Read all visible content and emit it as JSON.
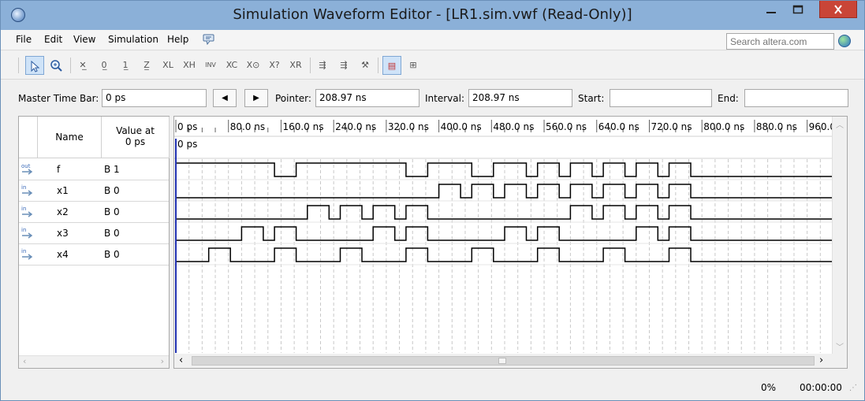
{
  "window": {
    "title": "Simulation Waveform Editor - [LR1.sim.vwf (Read-Only)]",
    "min_icon": "minimize-icon",
    "max_icon": "maximize-icon",
    "close_icon": "close-icon"
  },
  "menu": [
    "File",
    "Edit",
    "View",
    "Simulation",
    "Help"
  ],
  "search": {
    "placeholder": "Search altera.com"
  },
  "toolbar": {
    "icons": [
      "pointer-icon",
      "zoom-icon",
      "forcing-unknown-icon",
      "forcing-low-icon",
      "forcing-high-icon",
      "high-impedance-icon",
      "weak-low-icon",
      "weak-high-icon",
      "invert-icon",
      "count-value-icon",
      "clock-value-icon",
      "random-value-icon",
      "arbitrary-value-icon",
      "run-functional-icon",
      "run-timing-icon",
      "netlist-icon",
      "snap-to-grid-icon",
      "grid-settings-icon"
    ]
  },
  "timebar": {
    "master_label": "Master Time Bar:",
    "master_value": "0 ps",
    "pointer_label": "Pointer:",
    "pointer_value": "208.97 ns",
    "interval_label": "Interval:",
    "interval_value": "208.97 ns",
    "start_label": "Start:",
    "start_value": "",
    "end_label": "End:",
    "end_value": ""
  },
  "columns": {
    "name": "Name",
    "value_line1": "Value at",
    "value_line2": "0 ps"
  },
  "signals": [
    {
      "type": "out",
      "name": "f",
      "value": "B 1",
      "transitions": [
        0,
        150,
        183,
        350,
        383,
        450,
        483,
        533,
        550,
        583,
        600,
        633,
        650,
        683,
        700,
        733,
        750,
        783
      ],
      "start": 1
    },
    {
      "type": "in",
      "name": "x1",
      "value": "B 0",
      "transitions": [
        400,
        433,
        450,
        483,
        500,
        533,
        550,
        583,
        600,
        633,
        650,
        683,
        700,
        733,
        750,
        783
      ],
      "start": 0
    },
    {
      "type": "in",
      "name": "x2",
      "value": "B 0",
      "transitions": [
        200,
        233,
        250,
        283,
        300,
        333,
        350,
        383,
        600,
        633,
        650,
        683,
        700,
        733,
        750,
        783
      ],
      "start": 0
    },
    {
      "type": "in",
      "name": "x3",
      "value": "B 0",
      "transitions": [
        100,
        133,
        150,
        183,
        300,
        333,
        350,
        383,
        500,
        533,
        550,
        583,
        700,
        733,
        750,
        783
      ],
      "start": 0
    },
    {
      "type": "in",
      "name": "x4",
      "value": "B 0",
      "transitions": [
        50,
        83,
        150,
        183,
        250,
        283,
        350,
        383,
        450,
        483,
        550,
        583,
        650,
        683,
        750,
        783
      ],
      "start": 0
    }
  ],
  "time_ruler": {
    "labels": [
      "0 ps",
      "80.0 ns",
      "160.0 ns",
      "240.0 ns",
      "320.0 ns",
      "400.0 ns",
      "480.0 ns",
      "560.0 ns",
      "640.0 ns",
      "720.0 ns",
      "800.0 ns",
      "880.0 ns",
      "960.0 ns"
    ],
    "marker_label": "0 ps"
  },
  "status": {
    "progress": "0%",
    "elapsed": "00:00:00"
  }
}
